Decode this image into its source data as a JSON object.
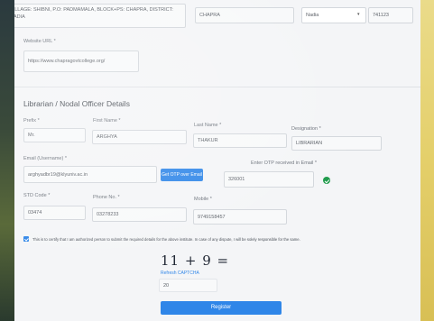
{
  "address": {
    "value": "VILLAGE: SHIBNI, P.O: PADMAMALA, BLOCK+PS: CHAPRA, DISTRICT: NADIA",
    "city": "CHAPRA",
    "district": "Nadia",
    "pincode": "741123"
  },
  "website": {
    "label": "Website URL *",
    "value": "https://www.chapragovtcollege.org/"
  },
  "librarian": {
    "section_title": "Librarian / Nodal Officer Details",
    "prefix_label": "Prefix *",
    "prefix_value": "Mr.",
    "first_name_label": "First Name *",
    "first_name_value": "ARGHYA",
    "last_name_label": "Last Name *",
    "last_name_value": "THAKUR",
    "designation_label": "Designation *",
    "designation_value": "LIBRARIAN",
    "email_label": "Email (Username) *",
    "email_value": "arghyadbr19@klyuniv.ac.in",
    "get_otp_label": "Get OTP over Email",
    "otp_label": "Enter OTP received in Email *",
    "otp_value": "326001",
    "std_label": "STD Code *",
    "std_value": "03474",
    "phone_label": "Phone No. *",
    "phone_value": "03278233",
    "mobile_label": "Mobile *",
    "mobile_value": "9749158457"
  },
  "declaration": {
    "text": "This is to certify that I am authorized person to submit the required details for the above institute. In case of any dispute, I will be solely responsible for the same."
  },
  "captcha": {
    "expression": "11 + 9 =",
    "refresh_label": "Refresh CAPTCHA",
    "answer": "20"
  },
  "register_label": "Register",
  "colors": {
    "accent": "#2f86e8",
    "success": "#1e9a4a",
    "page_bg": "#f4f5f7"
  }
}
